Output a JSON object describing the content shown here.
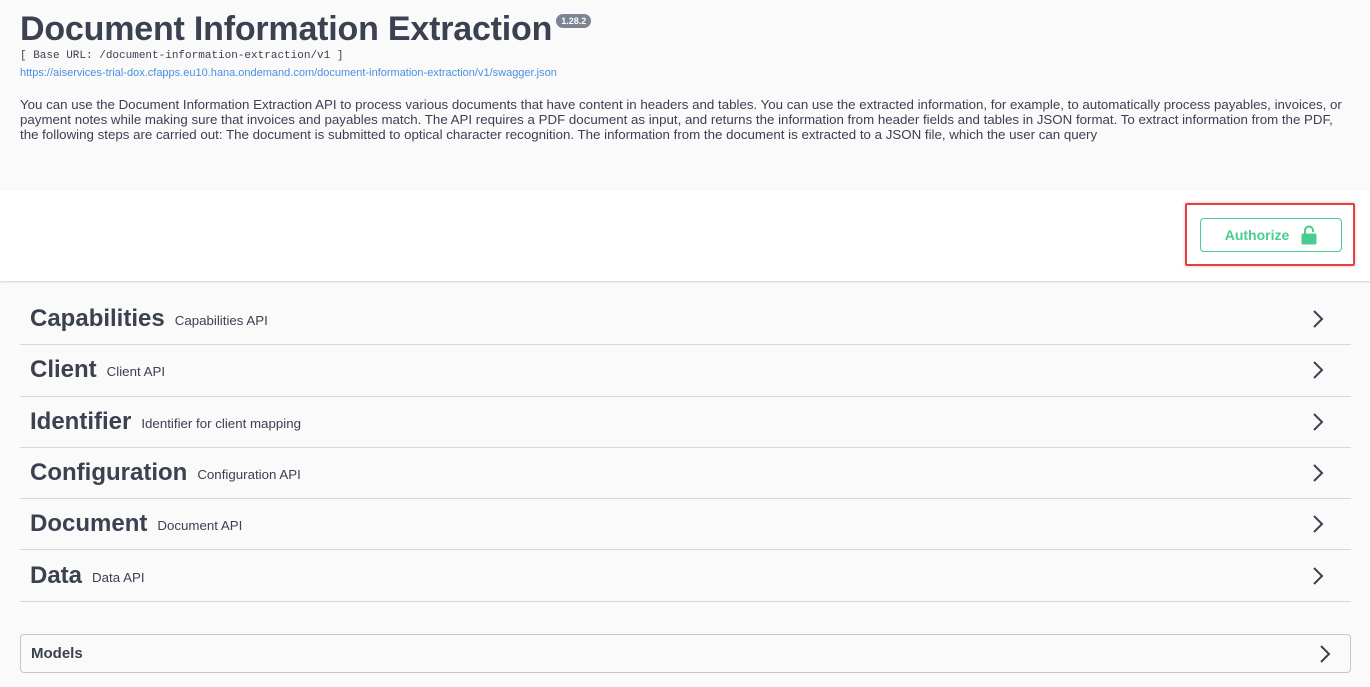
{
  "info": {
    "title": "Document Information Extraction",
    "version": "1.28.2",
    "base_url": "[ Base URL: /document-information-extraction/v1 ]",
    "spec_link": "https://aiservices-trial-dox.cfapps.eu10.hana.ondemand.com/document-information-extraction/v1/swagger.json",
    "description": "You can use the Document Information Extraction API to process various documents that have content in headers and tables. You can use the extracted information, for example, to automatically process payables, invoices, or payment notes while making sure that invoices and payables match. The API requires a PDF document as input, and returns the information from header fields and tables in JSON format. To extract information from the PDF, the following steps are carried out: The document is submitted to optical character recognition. The information from the document is extracted to a JSON file, which the user can query"
  },
  "authorize": {
    "label": "Authorize",
    "icon": "unlock-icon",
    "color": "#49cc90",
    "highlight_color": "#e0403f"
  },
  "tags": [
    {
      "name": "Capabilities",
      "description": "Capabilities API"
    },
    {
      "name": "Client",
      "description": "Client API"
    },
    {
      "name": "Identifier",
      "description": "Identifier for client mapping"
    },
    {
      "name": "Configuration",
      "description": "Configuration API"
    },
    {
      "name": "Document",
      "description": "Document API"
    },
    {
      "name": "Data",
      "description": "Data API"
    }
  ],
  "models": {
    "label": "Models"
  }
}
